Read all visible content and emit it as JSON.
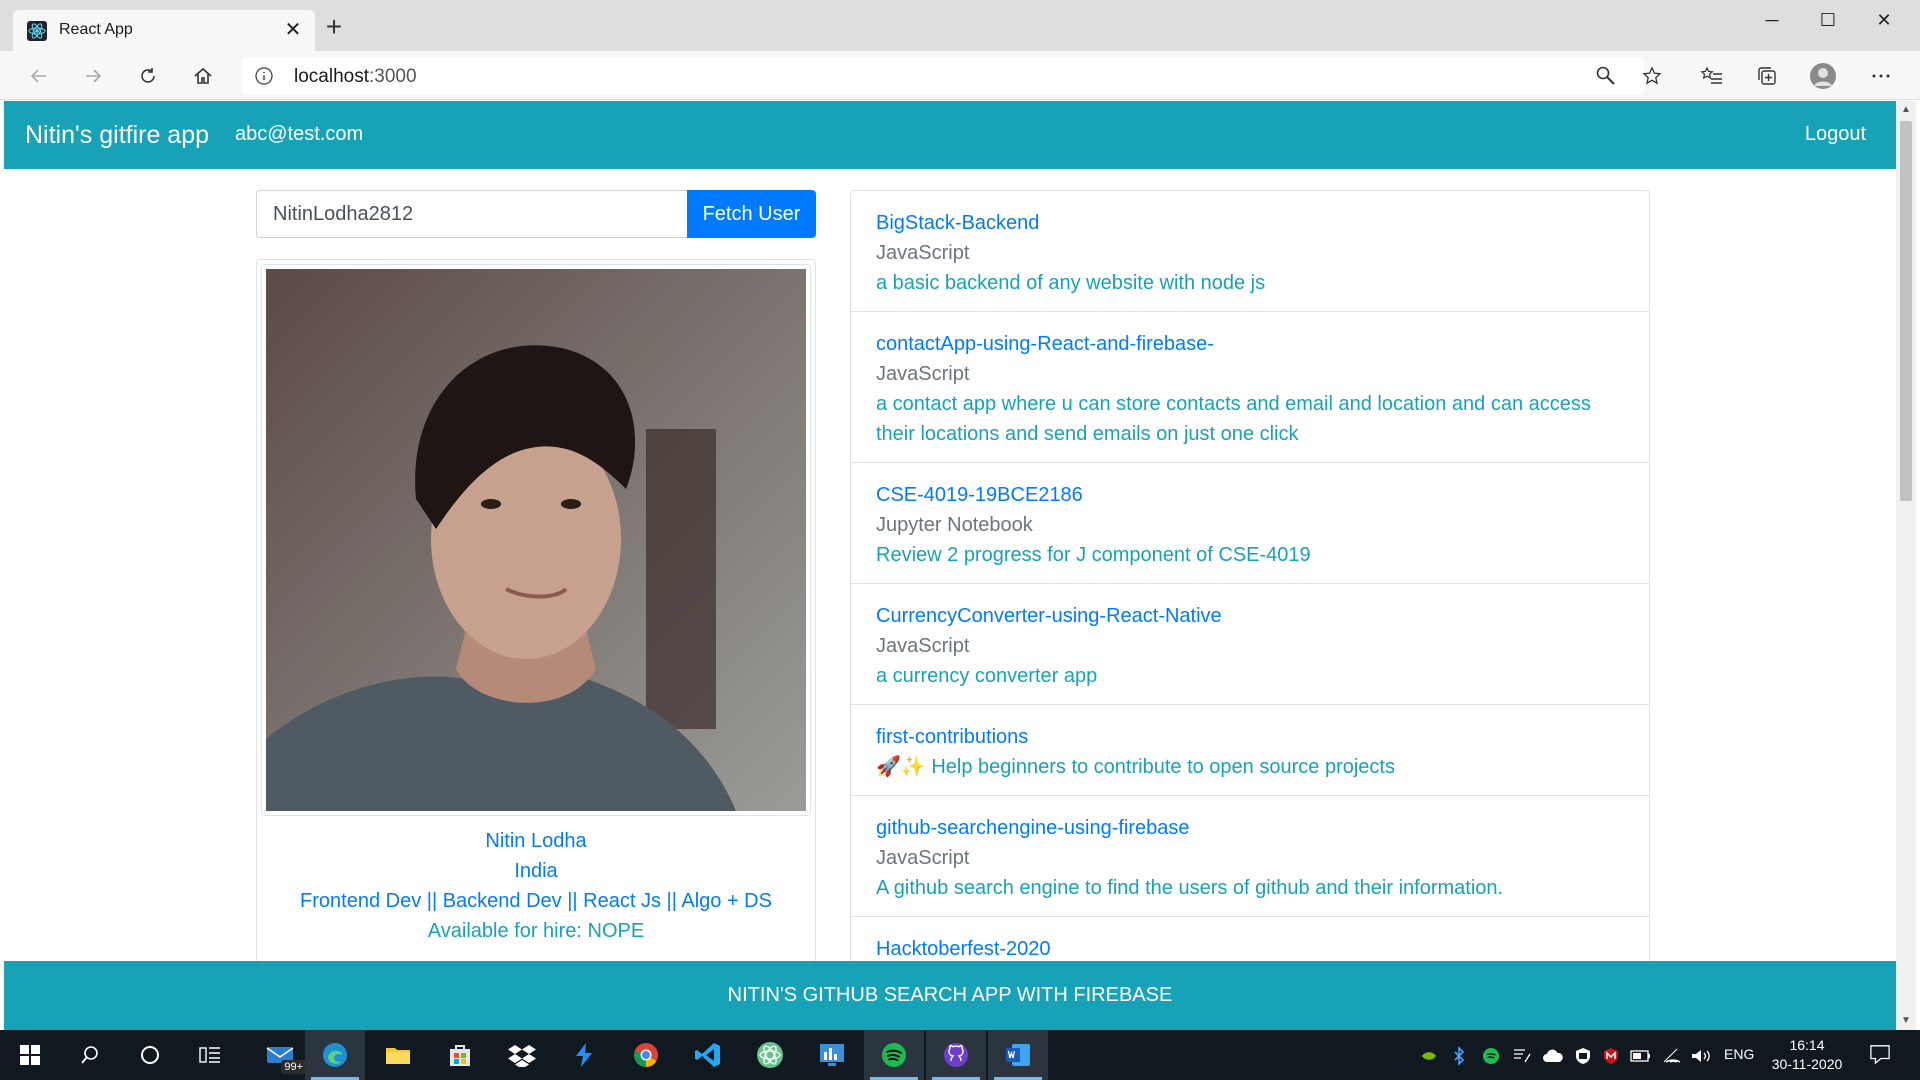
{
  "browser": {
    "tab_title": "React App",
    "url_host": "localhost",
    "url_port": ":3000"
  },
  "navbar": {
    "brand": "Nitin's gitfire app",
    "email": "abc@test.com",
    "logout": "Logout",
    "color": "#17a2b8"
  },
  "search": {
    "value": "NitinLodha2812",
    "button": "Fetch User"
  },
  "user": {
    "name": "Nitin Lodha",
    "location": "India",
    "bio": "Frontend Dev || Backend Dev || React Js || Algo + DS",
    "hire": "Available for hire: NOPE"
  },
  "repos": [
    {
      "name": "BigStack-Backend",
      "lang": "JavaScript",
      "desc": "a basic backend of any website with node js"
    },
    {
      "name": "contactApp-using-React-and-firebase-",
      "lang": "JavaScript",
      "desc": "a contact app where u can store contacts and email and location and can access their locations and send emails on just one click"
    },
    {
      "name": "CSE-4019-19BCE2186",
      "lang": "Jupyter Notebook",
      "desc": "Review 2 progress for J component of CSE-4019"
    },
    {
      "name": "CurrencyConverter-using-React-Native",
      "lang": "JavaScript",
      "desc": "a currency converter app"
    },
    {
      "name": "first-contributions",
      "lang": "",
      "desc": "🚀✨ Help beginners to contribute to open source projects"
    },
    {
      "name": "github-searchengine-using-firebase",
      "lang": "JavaScript",
      "desc": "A github search engine to find the users of github and their information."
    },
    {
      "name": "Hacktoberfest-2020",
      "lang": "",
      "desc": ""
    }
  ],
  "footer": {
    "text": "NITIN'S GITHUB SEARCH APP WITH FIREBASE"
  },
  "taskbar": {
    "mail_badge": "99+",
    "language": "ENG",
    "time": "16:14",
    "date": "30-11-2020"
  }
}
